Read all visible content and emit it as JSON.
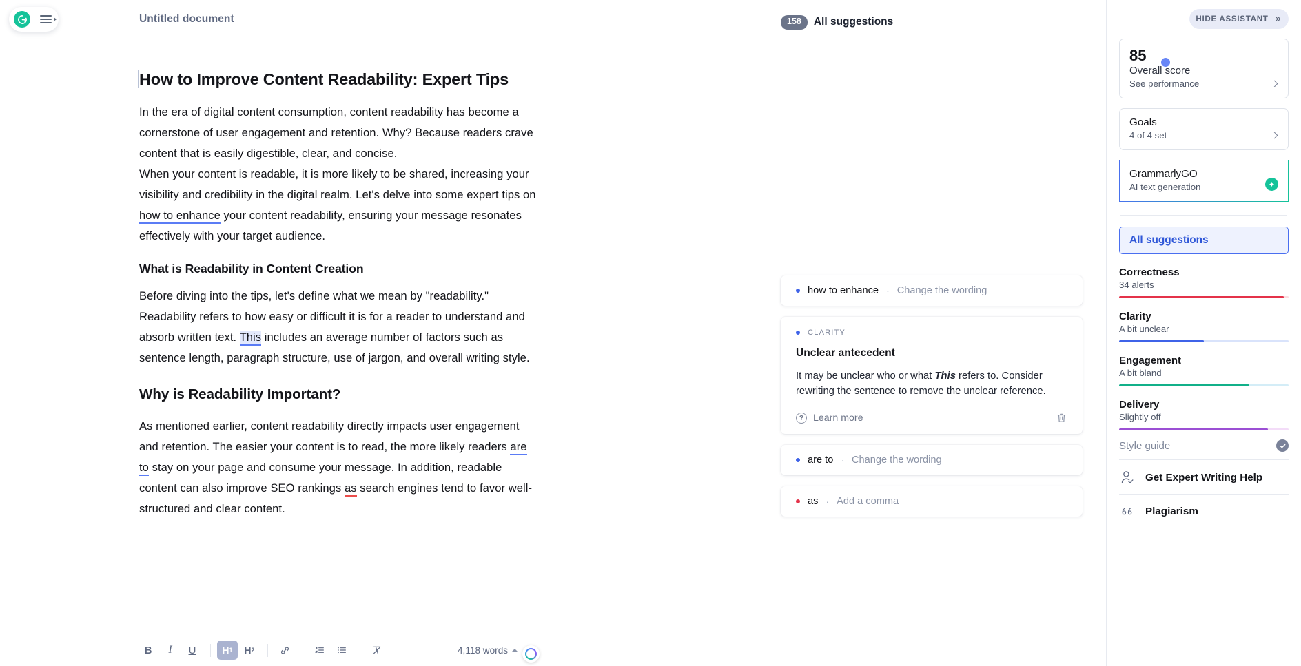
{
  "app": {
    "logo_icon": "grammarly-logo-icon",
    "menu_icon": "hamburger-menu-icon",
    "document_title": "Untitled document"
  },
  "document": {
    "heading": "How to Improve Content Readability: Expert Tips",
    "paragraph_1_a": "In the era of digital content consumption, content readability has become a cornerstone of user engagement and retention. Why? Because readers crave content that is easily digestible, clear, and concise.",
    "paragraph_1_b_pre": "When your content is readable, it is more likely to be shared, increasing your visibility and credibility in the digital realm. Let's delve into some expert tips on ",
    "paragraph_1_b_link": "how to enhance",
    "paragraph_1_b_post": " your content readability, ensuring your message resonates effectively with your target audience.",
    "subheading_1": "What is Readability in Content Creation",
    "paragraph_2_pre": "Before diving into the tips, let's define what we mean by \"readability.\" Readability refers to how easy or difficult it is for a reader to understand and absorb written text. ",
    "paragraph_2_highlight": "This",
    "paragraph_2_post": " includes an average number of factors such as sentence length, paragraph structure, use of jargon, and overall writing style.",
    "subheading_2": "Why is Readability Important?",
    "paragraph_3_pre": "As mentioned earlier, content readability directly impacts user engagement and retention. The easier your content is to read, the more likely readers ",
    "paragraph_3_link1": "are to",
    "paragraph_3_mid": " stay on your page and consume your message. In addition, readable content can also improve SEO rankings ",
    "paragraph_3_link2": "as",
    "paragraph_3_post": " search engines tend to favor well-structured and clear content."
  },
  "toolbar": {
    "bold_label": "B",
    "italic_label": "I",
    "underline_label": "U",
    "h1_label": "H",
    "h1_sub": "1",
    "h2_label": "H",
    "h2_sub": "2",
    "link_icon": "link-icon",
    "numbered_list_icon": "numbered-list-icon",
    "bullet_list_icon": "bullet-list-icon",
    "clear_format_icon": "clear-formatting-icon",
    "word_count": "4,118 words"
  },
  "suggestions_panel": {
    "count_badge": "158",
    "header_label": "All suggestions",
    "cards": [
      {
        "type": "collapsed",
        "dot_color": "blue",
        "target": "how to enhance",
        "separator": "·",
        "action": "Change the wording"
      },
      {
        "type": "expanded",
        "dot_color": "blue",
        "category": "CLARITY",
        "title": "Unclear antecedent",
        "text_pre": "It may be unclear who or what ",
        "text_bold": "This",
        "text_post": " refers to. Consider rewriting the sentence to remove the unclear reference.",
        "learn_more": "Learn more",
        "help_icon": "question-mark-icon",
        "dismiss_icon": "trash-icon"
      },
      {
        "type": "collapsed",
        "dot_color": "blue",
        "target": "are to",
        "separator": "·",
        "action": "Change the wording"
      },
      {
        "type": "collapsed",
        "dot_color": "red",
        "target": "as",
        "separator": "·",
        "action": "Add a comma"
      }
    ]
  },
  "sidebar": {
    "hide_assistant_label": "HIDE ASSISTANT",
    "hide_assistant_icon": "double-chevron-right-icon",
    "overall_score": {
      "value": "85",
      "label": "Overall score",
      "link": "See performance",
      "chevron_icon": "chevron-right-icon"
    },
    "goals": {
      "title": "Goals",
      "sub": "4 of 4 set",
      "chevron_icon": "chevron-right-icon"
    },
    "grammarly_go": {
      "title": "GrammarlyGO",
      "sub": "AI text generation",
      "badge_icon": "sparkle-badge-icon"
    },
    "all_suggestions_label": "All suggestions",
    "metrics": [
      {
        "name": "Correctness",
        "value": "34 alerts",
        "percent": 97,
        "color": "#e4334a",
        "track": "#fbdde1"
      },
      {
        "name": "Clarity",
        "value": "A bit unclear",
        "percent": 50,
        "color": "#3f63e8",
        "track": "#d9e3fb"
      },
      {
        "name": "Engagement",
        "value": "A bit bland",
        "percent": 77,
        "color": "#11b089",
        "track": "#d4edf7"
      },
      {
        "name": "Delivery",
        "value": "Slightly off",
        "percent": 88,
        "color": "#9b4fd4",
        "track": "#f3dcf8"
      }
    ],
    "style_guide": {
      "label": "Style guide",
      "icon": "check-circle-icon"
    },
    "expert_help": {
      "label": "Get Expert Writing Help",
      "icon": "person-check-icon"
    },
    "plagiarism": {
      "label": "Plagiarism",
      "icon": "quote-icon"
    }
  }
}
